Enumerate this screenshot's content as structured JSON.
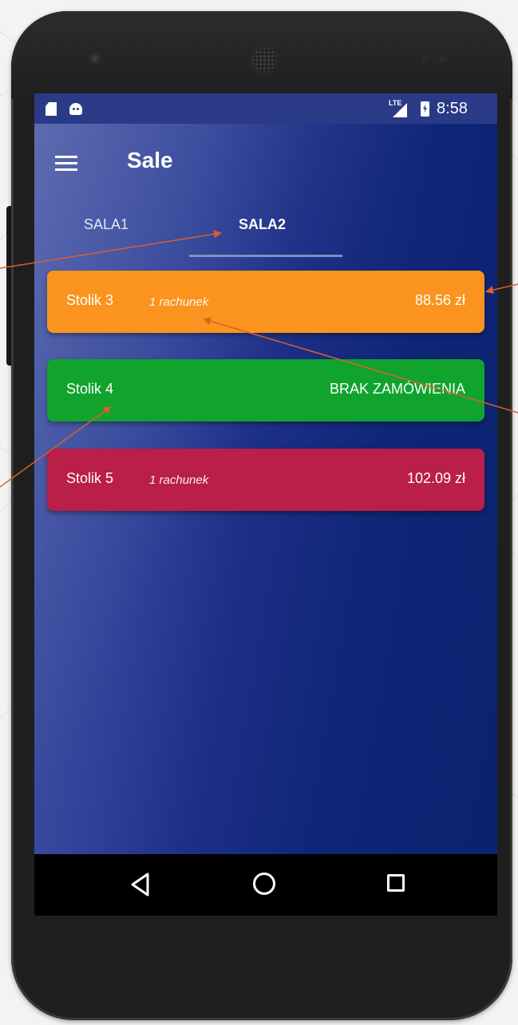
{
  "status_bar": {
    "network_label": "LTE",
    "time": "8:58",
    "icons": [
      "sd-card-icon",
      "android-icon",
      "signal-icon",
      "battery-charging-icon"
    ]
  },
  "app_bar": {
    "title": "Sale",
    "menu_icon": "hamburger-menu-icon"
  },
  "tabs": [
    {
      "label": "SALA1",
      "selected": false
    },
    {
      "label": "SALA2",
      "selected": true
    }
  ],
  "tables": [
    {
      "name": "Stolik 3",
      "bills": "1 rachunek",
      "amount": "88.56 zł",
      "color": "#fb931f"
    },
    {
      "name": "Stolik 4",
      "bills": "",
      "amount": "BRAK ZAMÓWIENIA",
      "color": "#10a42f"
    },
    {
      "name": "Stolik 5",
      "bills": "1 rachunek",
      "amount": "102.09 zł",
      "color": "#b91f48"
    }
  ],
  "nav_bar": {
    "icons": [
      "back-icon",
      "home-icon",
      "recent-apps-icon"
    ]
  },
  "colors": {
    "status_bar": "#2b3a86",
    "app_background": "#1c2f86",
    "annotation_arrow": "#d9622b"
  }
}
